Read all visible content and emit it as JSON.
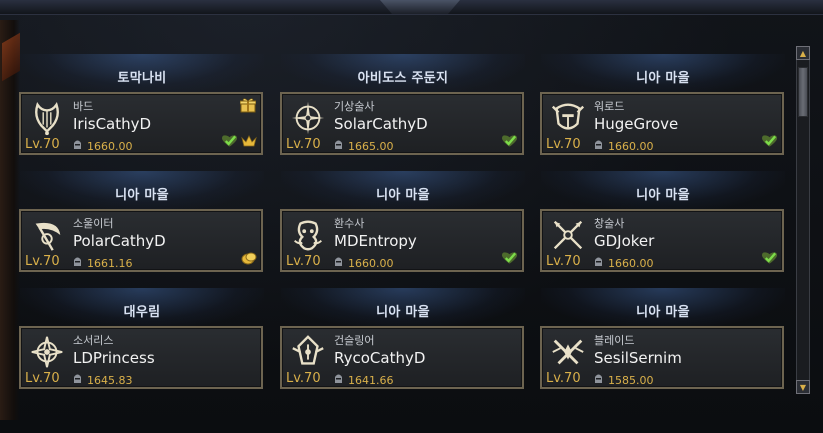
{
  "characters": [
    {
      "server": "토막나비",
      "class": "바드",
      "icon": "bard-harp-icon",
      "name": "IrisCathyD",
      "level": "Lv.70",
      "item_level": "1660.00",
      "badges": [
        "gift-icon",
        "check-heart-icon",
        "crown-icon"
      ]
    },
    {
      "server": "아비도스 주둔지",
      "class": "기상술사",
      "icon": "aeromancer-compass-icon",
      "name": "SolarCathyD",
      "level": "Lv.70",
      "item_level": "1665.00",
      "badges": [
        "check-heart-icon"
      ]
    },
    {
      "server": "니아 마을",
      "class": "워로드",
      "icon": "warlord-helm-icon",
      "name": "HugeGrove",
      "level": "Lv.70",
      "item_level": "1660.00",
      "badges": [
        "check-heart-icon"
      ]
    },
    {
      "server": "니아 마을",
      "class": "소울이터",
      "icon": "souleater-scythe-icon",
      "name": "PolarCathyD",
      "level": "Lv.70",
      "item_level": "1661.16",
      "badges": [
        "gold-coin-icon"
      ]
    },
    {
      "server": "니아 마을",
      "class": "환수사",
      "icon": "summoner-beast-icon",
      "name": "MDEntropy",
      "level": "Lv.70",
      "item_level": "1660.00",
      "badges": [
        "check-heart-icon"
      ]
    },
    {
      "server": "니아 마을",
      "class": "창술사",
      "icon": "lancer-spear-icon",
      "name": "GDJoker",
      "level": "Lv.70",
      "item_level": "1660.00",
      "badges": [
        "check-heart-icon"
      ]
    },
    {
      "server": "대우림",
      "class": "소서리스",
      "icon": "sorceress-star-icon",
      "name": "LDPrincess",
      "level": "Lv.70",
      "item_level": "1645.83",
      "badges": []
    },
    {
      "server": "니아 마을",
      "class": "건슬링어",
      "icon": "gunslinger-crest-icon",
      "name": "RycoCathyD",
      "level": "Lv.70",
      "item_level": "1641.66",
      "badges": []
    },
    {
      "server": "니아 마을",
      "class": "블레이드",
      "icon": "blade-swords-icon",
      "name": "SesilSernim",
      "level": "Lv.70",
      "item_level": "1585.00",
      "badges": []
    }
  ],
  "scrollbar": {
    "up": "▲",
    "down": "▼"
  },
  "colors": {
    "level": "#d9b04a",
    "card_border": "#6d6450",
    "header_glow": "#3c5f96"
  }
}
